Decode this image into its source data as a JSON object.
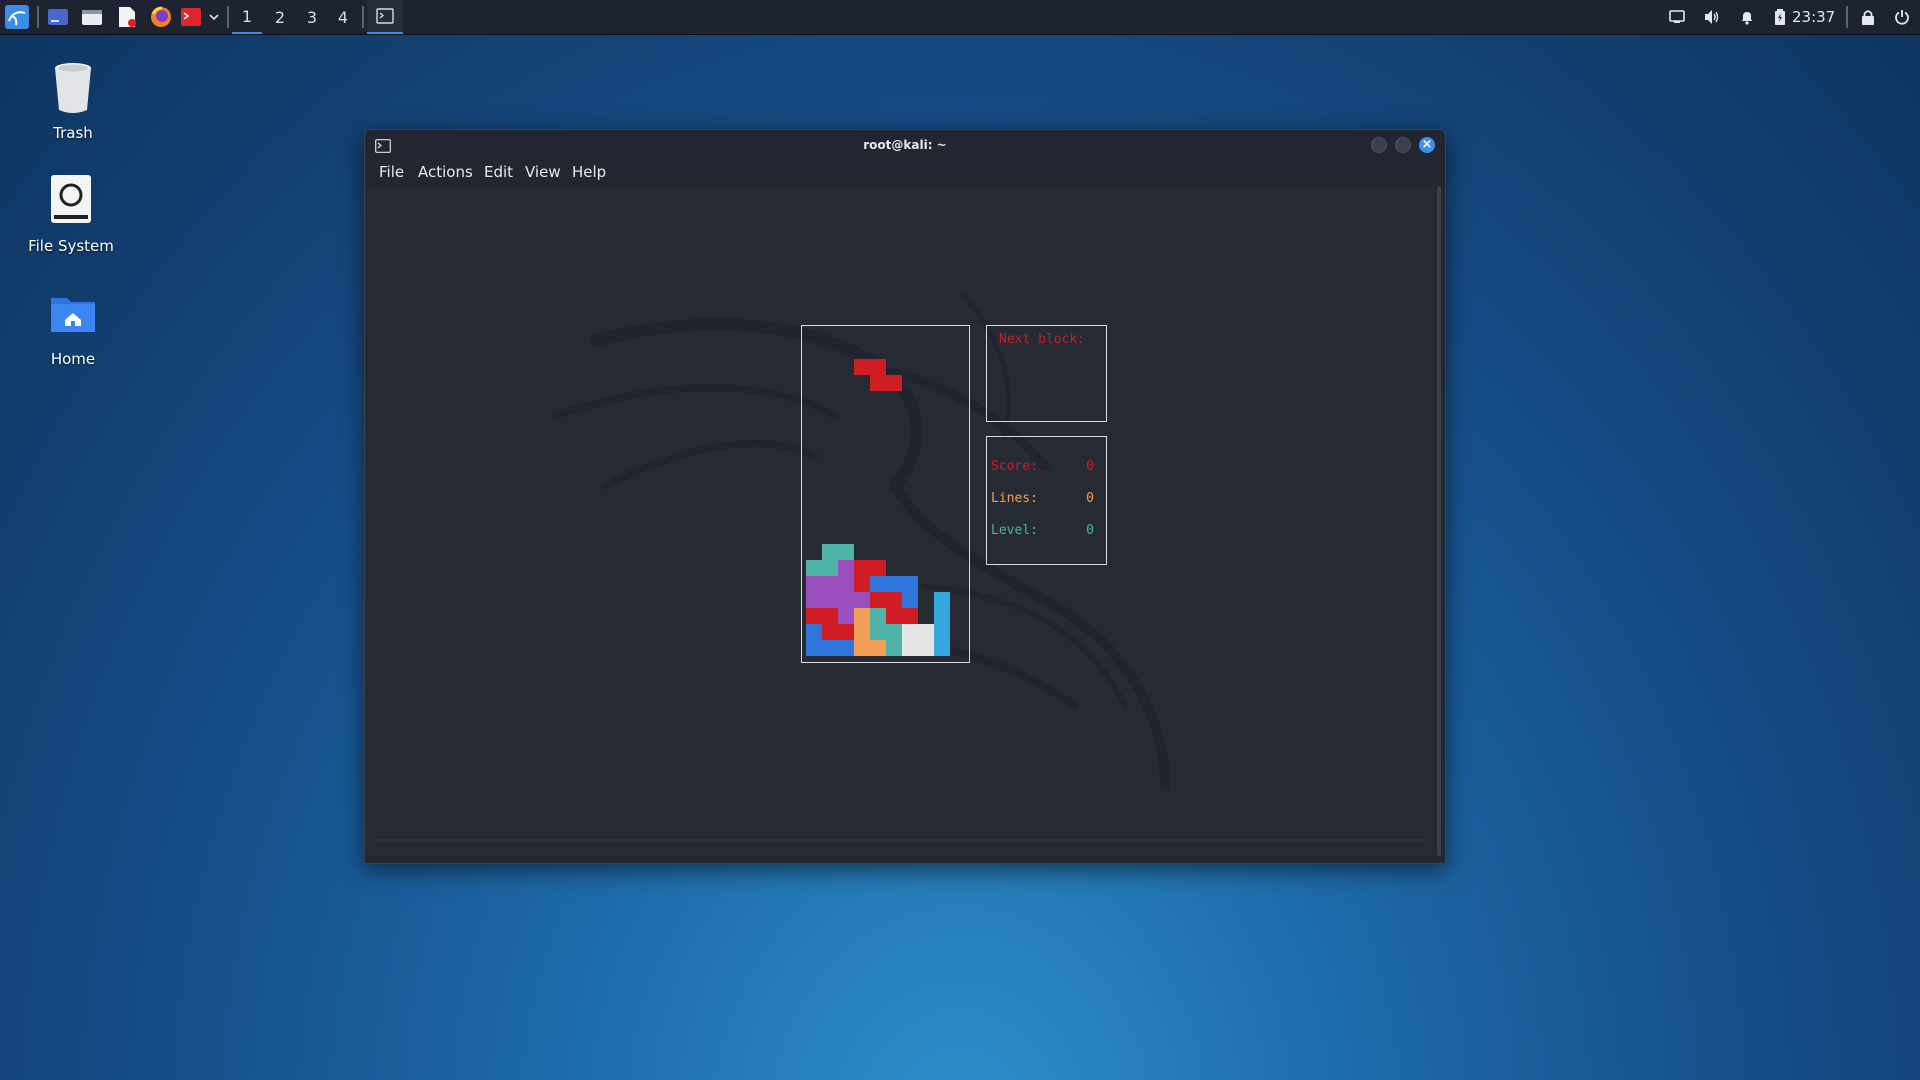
{
  "panel": {
    "workspaces": [
      "1",
      "2",
      "3",
      "4"
    ],
    "clock": "23:37",
    "icons": [
      "kali-menu-icon",
      "show-desktop-icon",
      "file-manager-icon",
      "text-editor-icon",
      "firefox-icon",
      "terminal-launcher-icon",
      "launcher-dropdown-icon",
      "display-icon",
      "volume-icon",
      "notifications-icon",
      "battery-icon",
      "lock-icon",
      "power-icon"
    ]
  },
  "desktop": {
    "icons": [
      {
        "label": "Trash"
      },
      {
        "label": "File System"
      },
      {
        "label": "Home"
      }
    ]
  },
  "window": {
    "title": "root@kali: ~",
    "menu": [
      "File",
      "Actions",
      "Edit",
      "View",
      "Help"
    ]
  },
  "game": {
    "next_label": "Next block:",
    "score_label": "Score:",
    "score": "0",
    "lines_label": "Lines:",
    "lines": "0",
    "level_label": "Level:",
    "level": "0",
    "colors": {
      "red": "#d01c24",
      "teal": "#4fb3a8",
      "purple": "#9b4fbf",
      "blue": "#2f75dc",
      "orange": "#f2a057",
      "white": "#e6e6e6",
      "cyan": "#36a7de",
      "score": "#d01c24",
      "lines": "#f2a057",
      "level": "#4fb3a8"
    }
  }
}
